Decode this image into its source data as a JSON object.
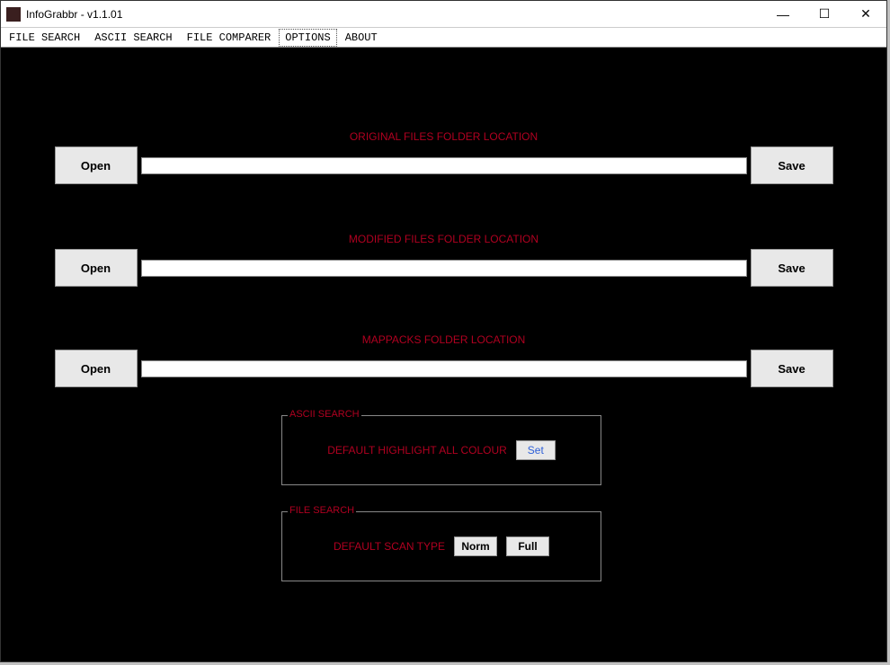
{
  "window": {
    "title": "InfoGrabbr - v1.1.01"
  },
  "tabs": [
    {
      "label": "FILE SEARCH",
      "active": false
    },
    {
      "label": "ASCII SEARCH",
      "active": false
    },
    {
      "label": "FILE COMPARER",
      "active": false
    },
    {
      "label": "OPTIONS",
      "active": true
    },
    {
      "label": "ABOUT",
      "active": false
    }
  ],
  "rows": {
    "original": {
      "label": "ORIGINAL FILES FOLDER LOCATION",
      "open": "Open",
      "save": "Save",
      "value": ""
    },
    "modified": {
      "label": "MODIFIED FILES FOLDER LOCATION",
      "open": "Open",
      "save": "Save",
      "value": ""
    },
    "mappacks": {
      "label": "MAPPACKS FOLDER LOCATION",
      "open": "Open",
      "save": "Save",
      "value": ""
    }
  },
  "ascii_group": {
    "legend": "ASCII SEARCH",
    "label": "DEFAULT HIGHLIGHT ALL COLOUR",
    "set": "Set"
  },
  "file_group": {
    "legend": "FILE SEARCH",
    "label": "DEFAULT SCAN TYPE",
    "norm": "Norm",
    "full": "Full"
  },
  "win_controls": {
    "minimize": "—",
    "maximize": "☐",
    "close": "✕"
  }
}
